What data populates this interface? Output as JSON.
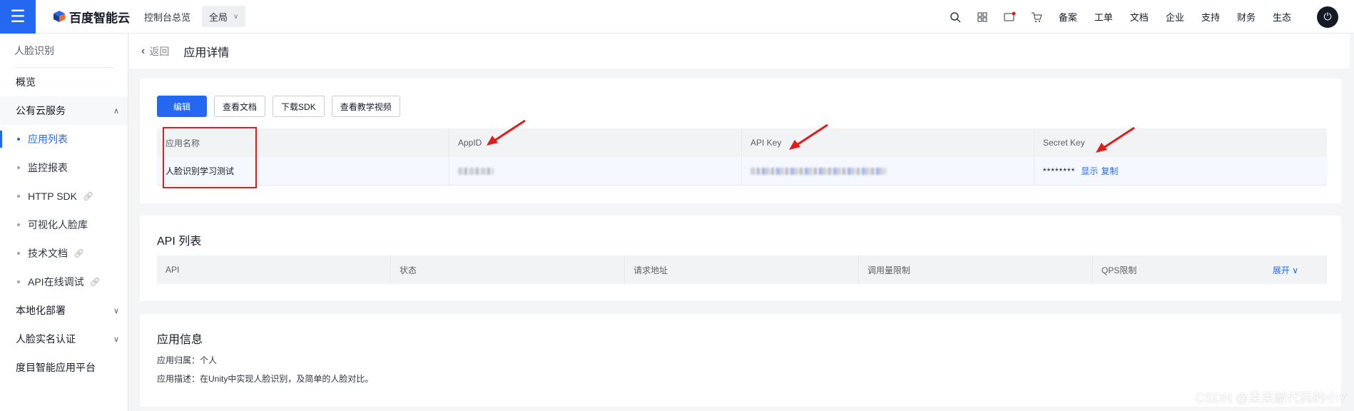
{
  "topbar": {
    "brand": "百度智能云",
    "console_link": "控制台总览",
    "scope": "全局",
    "nav": [
      "备案",
      "工单",
      "文档",
      "企业",
      "支持",
      "财务",
      "生态"
    ]
  },
  "sidebar": {
    "header": "人脸识别",
    "items": [
      {
        "label": "概览"
      },
      {
        "label": "公有云服务"
      },
      {
        "label": "应用列表"
      },
      {
        "label": "监控报表"
      },
      {
        "label": "HTTP SDK"
      },
      {
        "label": "可视化人脸库"
      },
      {
        "label": "技术文档"
      },
      {
        "label": "API在线调试"
      },
      {
        "label": "本地化部署"
      },
      {
        "label": "人脸实名认证"
      },
      {
        "label": "度目智能应用平台"
      }
    ]
  },
  "breadcrumb": {
    "back": "返回",
    "title": "应用详情"
  },
  "app_card": {
    "buttons": {
      "edit": "编辑",
      "view_docs": "查看文档",
      "download_sdk": "下载SDK",
      "view_videos": "查看教学视频"
    },
    "headers": [
      "应用名称",
      "AppID",
      "API Key",
      "Secret Key"
    ],
    "row": {
      "name": "人脸识别学习测试",
      "secret_masked": "********",
      "show": "显示",
      "copy": "复制"
    }
  },
  "api_card": {
    "title": "API 列表",
    "headers": [
      "API",
      "状态",
      "请求地址",
      "调用量限制",
      "QPS限制"
    ],
    "expand": "展开"
  },
  "info_card": {
    "title": "应用信息",
    "owner": "应用归属：个人",
    "description": "应用描述：在Unity中实现人脸识别，及简单的人脸对比。"
  },
  "watermark": "CSDN @呆呆敲代码的小Y",
  "colors": {
    "primary": "#2468f2",
    "annotation_red": "#e21b1b"
  }
}
